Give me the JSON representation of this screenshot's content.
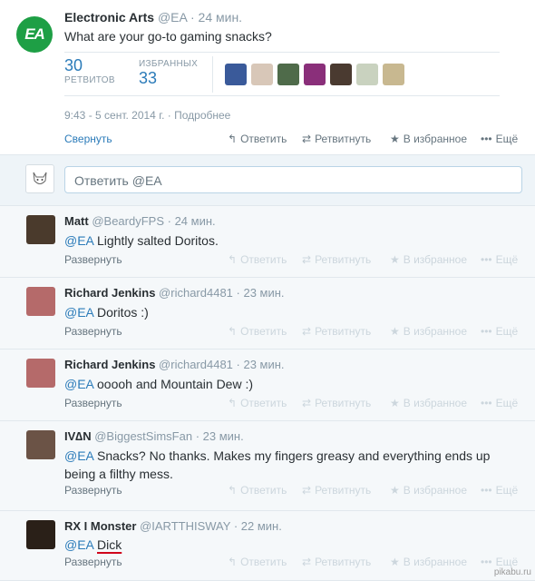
{
  "main_tweet": {
    "logo_text": "EA",
    "name": "Electronic Arts",
    "handle": "@EA",
    "time": "24 мин.",
    "text": "What are your go-to gaming snacks?",
    "retweets_count": "30",
    "retweets_label": "РЕТВИТОВ",
    "favorites_label": "ИЗБРАННЫХ",
    "favorites_count": "33",
    "date": "9:43 - 5 сент. 2014 г.",
    "details_link": "Подробнее",
    "collapse_label": "Свернуть",
    "avatar_colors": [
      "#3a5a9a",
      "#d8c7b8",
      "#4f6b4a",
      "#8a2f7a",
      "#4a3a30",
      "#c9d2bf",
      "#c8b890"
    ]
  },
  "actions": {
    "reply": "Ответить",
    "retweet": "Ретвитнуть",
    "favorite": "В избранное",
    "more": "Ещё",
    "reply_icon": "reply-arrow-icon",
    "retweet_icon": "retweet-icon",
    "favorite_icon": "star-icon",
    "more_icon": "more-dots-icon"
  },
  "reply_box": {
    "placeholder": "Ответить @EA"
  },
  "replies": [
    {
      "name": "Matt",
      "handle": "@BeardyFPS",
      "time": "24 мин.",
      "mention": "@EA",
      "text": "Lightly salted Doritos.",
      "expand": "Развернуть",
      "avatar_color": "#4a3a2c"
    },
    {
      "name": "Richard Jenkins",
      "handle": "@richard4481",
      "time": "23 мин.",
      "mention": "@EA",
      "text": "Doritos :)",
      "expand": "Развернуть",
      "avatar_color": "#b56a6a"
    },
    {
      "name": "Richard Jenkins",
      "handle": "@richard4481",
      "time": "23 мин.",
      "mention": "@EA",
      "text": "ooooh and Mountain Dew :)",
      "expand": "Развернуть",
      "avatar_color": "#b56a6a"
    },
    {
      "name": "IV∆N",
      "handle": "@BiggestSimsFan",
      "time": "23 мин.",
      "mention": "@EA",
      "text": "Snacks? No thanks. Makes my fingers greasy and everything ends up being a filthy mess.",
      "expand": "Развернуть",
      "avatar_color": "#6b5346"
    },
    {
      "name": "RX I Monster",
      "handle": "@IARTTHISWAY",
      "time": "22 мин.",
      "mention": "@EA",
      "text": "Dick",
      "expand": "Развернуть",
      "avatar_color": "#2a2018"
    }
  ],
  "watermark": "pikabu.ru"
}
